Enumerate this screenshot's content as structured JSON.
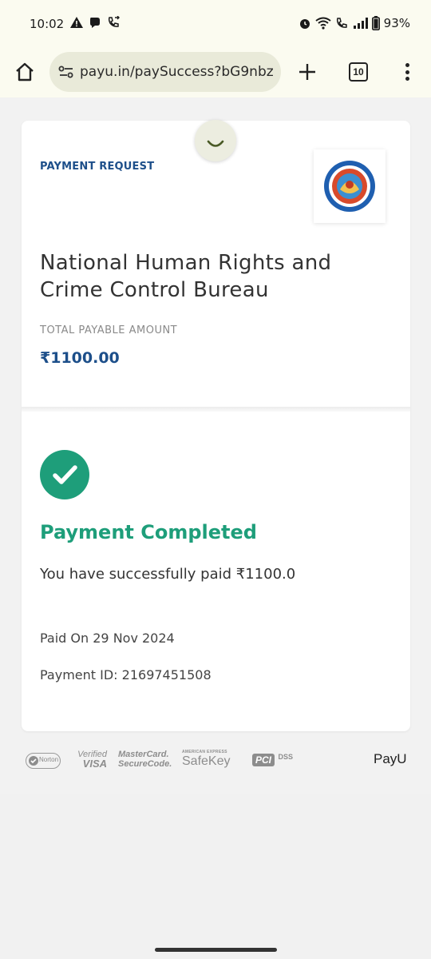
{
  "status_bar": {
    "time": "10:02",
    "battery": "93%"
  },
  "browser": {
    "url": "payu.in/paySuccess?bG9nbz",
    "tab_count": "10",
    "progress_percent": 30
  },
  "payment": {
    "request_label": "PAYMENT REQUEST",
    "merchant_name": "National Human Rights and Crime Control Bureau",
    "total_label": "TOTAL PAYABLE AMOUNT",
    "total_amount": "₹1100.00",
    "status_title": "Payment Completed",
    "status_message": "You have successfully paid ₹1100.0",
    "paid_on": "Paid On 29 Nov 2024",
    "payment_id": "Payment ID: 21697451508"
  },
  "footer": {
    "badges": {
      "norton": "Norton",
      "verified_visa_line1": "Verified",
      "verified_visa_line2": "VISA",
      "mastercard_line1": "MasterCard.",
      "mastercard_line2": "SecureCode.",
      "amex_line1": "AMERICAN EXPRESS",
      "amex_line2": "SafeKey",
      "pci": "PCI",
      "dss": "DSS"
    },
    "payu_logo": "PayU"
  },
  "colors": {
    "accent_green": "#1e9e7a",
    "accent_blue": "#1d4f8a",
    "browser_bg": "#fbfbf0"
  }
}
